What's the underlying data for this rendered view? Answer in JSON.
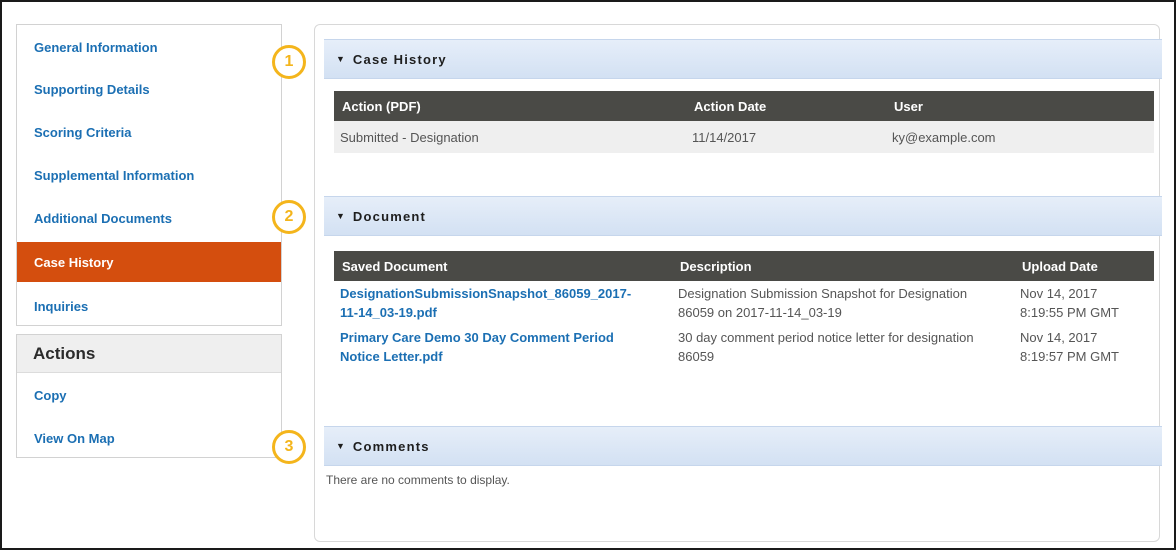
{
  "sidebar": {
    "items": [
      {
        "label": "General Information"
      },
      {
        "label": "Supporting Details"
      },
      {
        "label": "Scoring Criteria"
      },
      {
        "label": "Supplemental Information"
      },
      {
        "label": "Additional Documents"
      },
      {
        "label": "Case History",
        "active": true
      },
      {
        "label": "Inquiries"
      }
    ],
    "active_color": "#d44e0e",
    "link_color": "#1b6fb3"
  },
  "actions": {
    "title": "Actions",
    "items": [
      {
        "label": "Copy"
      },
      {
        "label": "View On Map"
      }
    ]
  },
  "markers": [
    "1",
    "2",
    "3"
  ],
  "marker_color": "#f4b51c",
  "case_history": {
    "title": "Case History",
    "caret_icon": "caret-down-icon",
    "columns": [
      "Action (PDF)",
      "Action Date",
      "User"
    ],
    "rows": [
      [
        "Submitted - Designation",
        "11/14/2017",
        "ky@example.com"
      ]
    ]
  },
  "document": {
    "title": "Document",
    "columns": [
      "Saved Document",
      "Description",
      "Upload Date"
    ],
    "rows": [
      {
        "name_line1": "DesignationSubmissionSnapshot_86059_2017-",
        "name_line2": "11-14_03-19.pdf",
        "desc_line1": "Designation Submission Snapshot for Designation",
        "desc_line2": "86059 on 2017-11-14_03-19",
        "date_line1": "Nov 14, 2017",
        "date_line2": "8:19:55 PM GMT"
      },
      {
        "name_line1": "Primary Care Demo 30 Day Comment Period",
        "name_line2": "Notice Letter.pdf",
        "desc_line1": "30 day comment period notice letter for designation",
        "desc_line2": "86059",
        "date_line1": "Nov 14, 2017",
        "date_line2": "8:19:57 PM GMT"
      }
    ]
  },
  "comments": {
    "title": "Comments",
    "empty_text": "There are no comments to display."
  }
}
